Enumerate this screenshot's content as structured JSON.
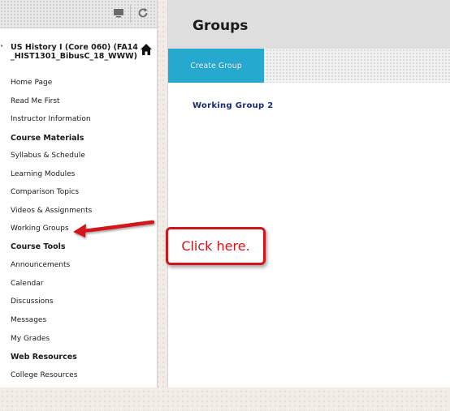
{
  "sidebar": {
    "course_title": "US History I (Core 060) (FA14_HIST1301_BibusC_18_WWW)",
    "items": [
      {
        "label": "Home Page",
        "type": "link"
      },
      {
        "label": "Read Me First",
        "type": "link"
      },
      {
        "label": "Instructor Information",
        "type": "link"
      },
      {
        "label": "Course Materials",
        "type": "header"
      },
      {
        "label": "Syllabus & Schedule",
        "type": "link"
      },
      {
        "label": "Learning Modules",
        "type": "link"
      },
      {
        "label": "Comparison Topics",
        "type": "link"
      },
      {
        "label": "Videos & Assignments",
        "type": "link"
      },
      {
        "label": "Working Groups",
        "type": "link"
      },
      {
        "label": "Course Tools",
        "type": "header"
      },
      {
        "label": "Announcements",
        "type": "link"
      },
      {
        "label": "Calendar",
        "type": "link"
      },
      {
        "label": "Discussions",
        "type": "link"
      },
      {
        "label": "Messages",
        "type": "link"
      },
      {
        "label": "My Grades",
        "type": "link"
      },
      {
        "label": "Web Resources",
        "type": "header"
      },
      {
        "label": "College Resources",
        "type": "link"
      }
    ],
    "toolbar_icons": [
      "display-icon",
      "refresh-icon"
    ],
    "home_icon": "home-icon"
  },
  "main": {
    "title": "Groups",
    "create_button_label": "Create Group",
    "groups": [
      "Working Group 2"
    ]
  },
  "annotation": {
    "callout_text": "Click here."
  },
  "colors": {
    "accent": "#25a9cf",
    "callout_red": "#d2151b",
    "link_navy": "#1a2a7a"
  }
}
